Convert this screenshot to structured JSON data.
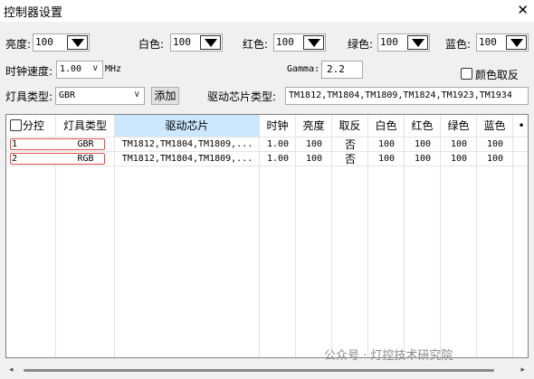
{
  "window": {
    "title": "控制器设置"
  },
  "params": {
    "brightness": {
      "label": "亮度:",
      "value": "100"
    },
    "white": {
      "label": "白色:",
      "value": "100"
    },
    "red": {
      "label": "红色:",
      "value": "100"
    },
    "green": {
      "label": "绿色:",
      "value": "100"
    },
    "blue": {
      "label": "蓝色:",
      "value": "100"
    },
    "clock": {
      "label": "时钟速度:",
      "value": "1.00",
      "unit": "MHz"
    },
    "gamma": {
      "label": "Gamma:",
      "value": "2.2"
    },
    "invert_color": {
      "label": "颜色取反",
      "checked": false
    },
    "lamp_type": {
      "label": "灯具类型:",
      "value": "GBR"
    },
    "add_button": "添加",
    "chip_type": {
      "label": "驱动芯片类型:",
      "value": "TM1812,TM1804,TM1809,TM1824,TM1923,TM1934"
    }
  },
  "table": {
    "headers": [
      "分控",
      "灯具类型",
      "驱动芯片",
      "时钟",
      "亮度",
      "取反",
      "白色",
      "红色",
      "绿色",
      "蓝色"
    ],
    "rows": [
      {
        "id": "1",
        "type": "GBR",
        "chip": "TM1812,TM1804,TM1809,...",
        "clock": "1.00",
        "brightness": "100",
        "invert": "否",
        "white": "100",
        "red": "100",
        "green": "100",
        "blue": "100"
      },
      {
        "id": "2",
        "type": "RGB",
        "chip": "TM1812,TM1804,TM1809,...",
        "clock": "1.00",
        "brightness": "100",
        "invert": "否",
        "white": "100",
        "red": "100",
        "green": "100",
        "blue": "100"
      }
    ]
  },
  "watermark": "公众号 · 灯控技术研究院",
  "colors": {
    "header_selected": "#cce8ff",
    "row_highlight_border": "#d9534f"
  }
}
